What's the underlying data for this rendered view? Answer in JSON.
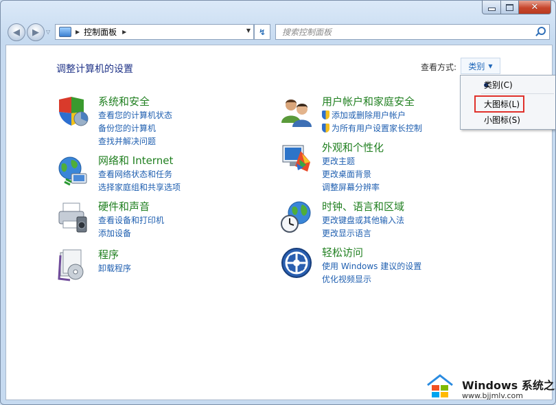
{
  "window": {
    "caption_buttons": [
      "minimize",
      "maximize",
      "close"
    ]
  },
  "navigation": {
    "breadcrumb": "控制面板",
    "search_placeholder": "搜索控制面板"
  },
  "main": {
    "title": "调整计算机的设置",
    "view_by_label": "查看方式:",
    "view_by_value": "类别"
  },
  "view_menu": {
    "items": [
      {
        "label": "类别(C)",
        "selected": true
      },
      {
        "label": "大图标(L)",
        "highlighted": true
      },
      {
        "label": "小图标(S)"
      }
    ]
  },
  "categories": {
    "system": {
      "title": "系统和安全",
      "links": [
        "查看您的计算机状态",
        "备份您的计算机",
        "查找并解决问题"
      ]
    },
    "network": {
      "title": "网络和 Internet",
      "links": [
        "查看网络状态和任务",
        "选择家庭组和共享选项"
      ]
    },
    "hardware": {
      "title": "硬件和声音",
      "links": [
        "查看设备和打印机",
        "添加设备"
      ]
    },
    "programs": {
      "title": "程序",
      "links": [
        "卸载程序"
      ]
    },
    "users": {
      "title": "用户帐户和家庭安全",
      "links": [
        "添加或删除用户帐户",
        "为所有用户设置家长控制"
      ]
    },
    "appearance": {
      "title": "外观和个性化",
      "links": [
        "更改主题",
        "更改桌面背景",
        "调整屏幕分辨率"
      ]
    },
    "clock": {
      "title": "时钟、语言和区域",
      "links": [
        "更改键盘或其他输入法",
        "更改显示语言"
      ]
    },
    "access": {
      "title": "轻松访问",
      "links": [
        "使用 Windows 建议的设置",
        "优化视频显示"
      ]
    }
  },
  "watermark": {
    "brand": "Windows 系统之家",
    "url": "www.bjjmlv.com"
  }
}
